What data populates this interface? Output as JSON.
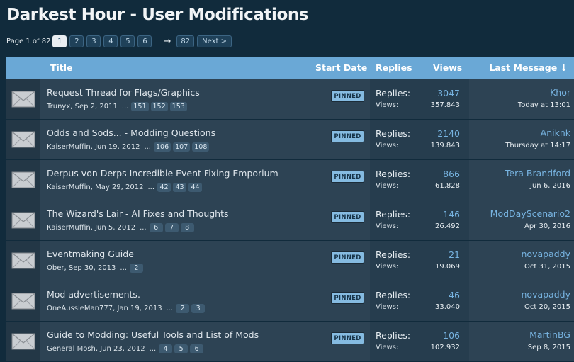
{
  "forum": {
    "title": "Darkest Hour - User Modifications"
  },
  "pagination": {
    "page_text": "Page 1 of 82",
    "pages": [
      "1",
      "2",
      "3",
      "4",
      "5",
      "6"
    ],
    "arrow": "→",
    "last_page": "82",
    "next_label": "Next >"
  },
  "columns": {
    "title": "Title",
    "start_date": "Start Date",
    "replies": "Replies",
    "views": "Views",
    "last_message": "Last Message ↓"
  },
  "labels": {
    "pinned": "PINNED",
    "replies": "Replies:",
    "views": "Views:",
    "dots": "..."
  },
  "colors": {
    "background": "#112b3c",
    "header": "#6aa8d6",
    "row": "#2d4354",
    "link": "#77b3e0"
  },
  "icons": {
    "thread": "envelope-icon"
  },
  "threads": [
    {
      "title": "Request Thread for Flags/Graphics",
      "author": "Trunyx",
      "date": "Sep 2, 2011",
      "pages": [
        "151",
        "152",
        "153"
      ],
      "replies": "3047",
      "views": "357.843",
      "last_user": "Khor",
      "last_date": "Today at 13:01"
    },
    {
      "title": "Odds and Sods... - Modding Questions",
      "author": "KaiserMuffin",
      "date": "Jun 19, 2012",
      "pages": [
        "106",
        "107",
        "108"
      ],
      "replies": "2140",
      "views": "139.843",
      "last_user": "Aniknk",
      "last_date": "Thursday at 14:17"
    },
    {
      "title": "Derpus von Derps Incredible Event Fixing Emporium",
      "author": "KaiserMuffin",
      "date": "May 29, 2012",
      "pages": [
        "42",
        "43",
        "44"
      ],
      "replies": "866",
      "views": "61.828",
      "last_user": "Tera Brandford",
      "last_date": "Jun 6, 2016"
    },
    {
      "title": "The Wizard's Lair - AI Fixes and Thoughts",
      "author": "KaiserMuffin",
      "date": "Jun 5, 2012",
      "pages": [
        "6",
        "7",
        "8"
      ],
      "replies": "146",
      "views": "26.492",
      "last_user": "ModDayScenario2",
      "last_date": "Apr 30, 2016"
    },
    {
      "title": "Eventmaking Guide",
      "author": "Ober",
      "date": "Sep 30, 2013",
      "pages": [
        "2"
      ],
      "replies": "21",
      "views": "19.069",
      "last_user": "novapaddy",
      "last_date": "Oct 31, 2015"
    },
    {
      "title": "Mod advertisements.",
      "author": "OneAussieMan777",
      "date": "Jan 19, 2013",
      "pages": [
        "2",
        "3"
      ],
      "replies": "46",
      "views": "33.040",
      "last_user": "novapaddy",
      "last_date": "Oct 20, 2015"
    },
    {
      "title": "Guide to Modding: Useful Tools and List of Mods",
      "author": "General Mosh",
      "date": "Jun 23, 2012",
      "pages": [
        "4",
        "5",
        "6"
      ],
      "replies": "106",
      "views": "102.932",
      "last_user": "MartinBG",
      "last_date": "Sep 8, 2015"
    }
  ]
}
